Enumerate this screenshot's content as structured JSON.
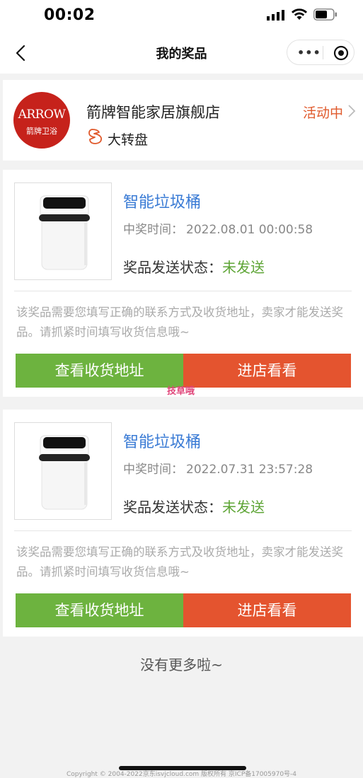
{
  "status_bar": {
    "time": "00:02"
  },
  "nav": {
    "title": "我的奖品"
  },
  "shop": {
    "logo_text": "ARROW",
    "logo_subtext": "箭牌卫浴",
    "name": "箭牌智能家居旗舰店",
    "activity": "大转盘",
    "status": "活动中",
    "colors": {
      "status": "#e05a2c",
      "logo_bg": "#c6221b"
    }
  },
  "prizes": [
    {
      "name": "智能垃圾桶",
      "time_label": "中奖时间：",
      "time": "2022.08.01 00:00:58",
      "ship_label": "奖品发送状态：",
      "ship_status": "未发送",
      "note": "该奖品需要您填写正确的联系方式及收货地址，卖家才能发送奖品。请抓紧时间填写收货信息哦~",
      "btn_address": "查看收货地址",
      "btn_shop": "进店看看"
    },
    {
      "name": "智能垃圾桶",
      "time_label": "中奖时间：",
      "time": "2022.07.31 23:57:28",
      "ship_label": "奖品发送状态：",
      "ship_status": "未发送",
      "note": "该奖品需要您填写正确的联系方式及收货地址，卖家才能发送奖品。请抓紧时间填写收货信息哦~",
      "btn_address": "查看收货地址",
      "btn_shop": "进店看看"
    }
  ],
  "watermark": "技草哦",
  "footer": {
    "no_more": "没有更多啦~",
    "copyright": "Copyright © 2004-2022京东isvjcloud.com 版权所有 京ICP备17005970号-4"
  },
  "colors": {
    "accent_blue": "#3a7bd5",
    "green": "#6db33f",
    "red": "#e4542f",
    "status_green": "#5ea536"
  },
  "icons": [
    "back-icon",
    "more-icon",
    "close-target-icon",
    "activity-wheel-icon",
    "chevron-right-icon",
    "signal-icon",
    "wifi-icon",
    "battery-icon"
  ]
}
